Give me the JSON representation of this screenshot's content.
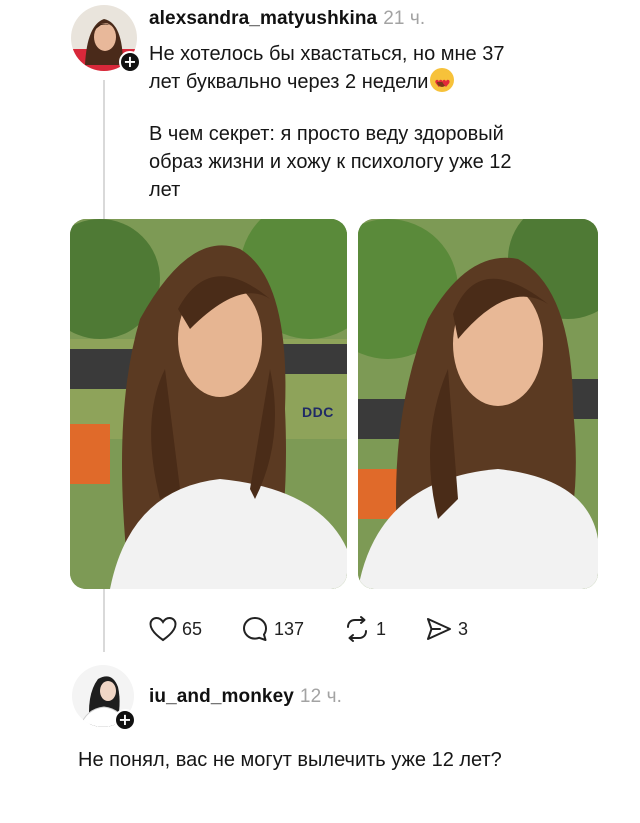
{
  "post": {
    "username": "alexsandra_matyushkina",
    "time": "21 ч.",
    "text_line1": "Не хотелось бы хвастаться, но мне 37",
    "text_line2": "лет буквально через 2 недели",
    "emoji_icon": "heart-eyes-emoji",
    "paragraph2_line1": "В чем секрет: я просто веду здоровый",
    "paragraph2_line2": "образ жизни и хожу к психологу уже 12",
    "paragraph2_line3": "лет",
    "watermark": "DDC",
    "likes": "65",
    "comments": "137",
    "reposts": "1",
    "shares": "3"
  },
  "reply": {
    "username": "iu_and_monkey",
    "time": "12 ч.",
    "text": "Не понял, вас не могут вылечить уже 12 лет?"
  },
  "colors": {
    "text": "#161616",
    "muted": "#a3a3a3",
    "thread_line": "#d9d9d9",
    "watermark": "#1f2a66"
  }
}
